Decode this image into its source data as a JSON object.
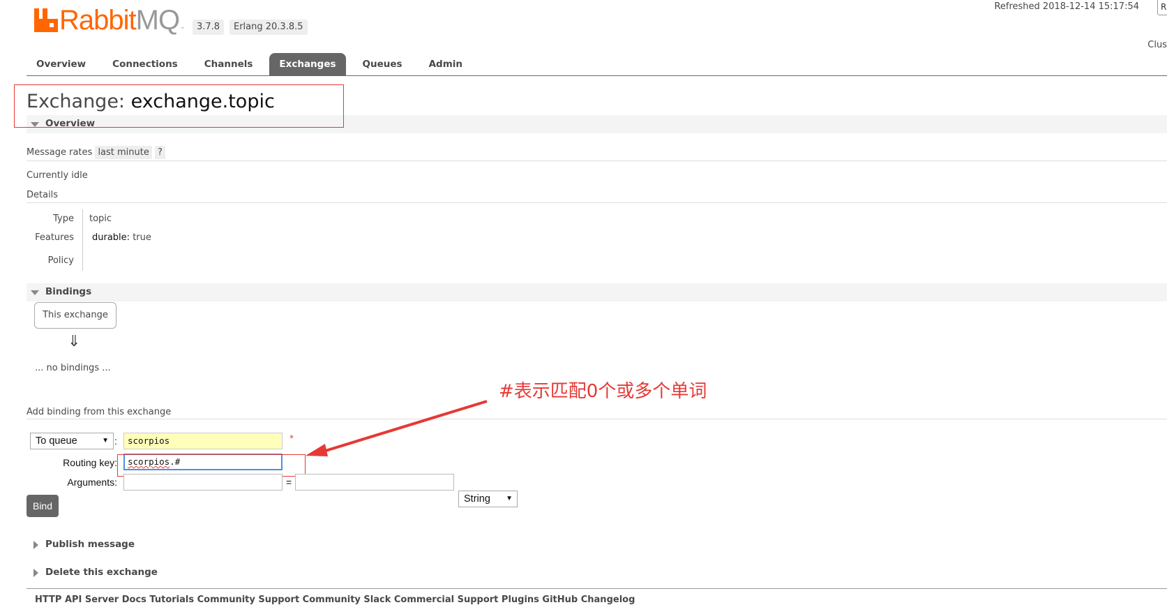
{
  "header": {
    "logo_text": "RabbitMQ",
    "version": "3.7.8",
    "erlang": "Erlang 20.3.8.5",
    "refreshed": "Refreshed 2018-12-14 15:17:54",
    "refresh_button_label": "R",
    "cluster_label": "Clus"
  },
  "tabs": [
    {
      "label": "Overview",
      "active": false
    },
    {
      "label": "Connections",
      "active": false
    },
    {
      "label": "Channels",
      "active": false
    },
    {
      "label": "Exchanges",
      "active": true
    },
    {
      "label": "Queues",
      "active": false
    },
    {
      "label": "Admin",
      "active": false
    }
  ],
  "page": {
    "title_prefix": "Exchange:",
    "title_name": "exchange.topic"
  },
  "overview": {
    "section_label": "Overview",
    "message_rates_label": "Message rates",
    "message_rates_value": "last minute",
    "help_label": "?",
    "idle_text": "Currently idle",
    "details_label": "Details",
    "type_label": "Type",
    "type_value": "topic",
    "features_label": "Features",
    "durable_label": "durable:",
    "durable_value": "true",
    "policy_label": "Policy",
    "policy_value": ""
  },
  "bindings": {
    "section_label": "Bindings",
    "this_exchange_label": "This exchange",
    "arrow": "⇓",
    "no_bindings_text": "... no bindings ..."
  },
  "add_binding": {
    "heading": "Add binding from this exchange",
    "destination_type": "To queue",
    "colon": ":",
    "destination_value": "scorpios",
    "required_mark": "*",
    "routing_key_label": "Routing key:",
    "routing_key_word": "scorpios",
    "routing_key_suffix": ".#",
    "arguments_label": "Arguments:",
    "argument_key": "",
    "equals": "=",
    "argument_value": "",
    "argument_type": "String",
    "bind_label": "Bind"
  },
  "collapsed_sections": {
    "publish_label": "Publish message",
    "delete_label": "Delete this exchange"
  },
  "annotation": {
    "text": "#表示匹配0个或多个单词",
    "color": "#e53935"
  },
  "footer": {
    "links_text": "HTTP API    Server Docs    Tutorials    Community Support    Community Slack    Commercial Support    Plugins    GitHub    Changelog"
  },
  "colors": {
    "brand_orange": "#ff6600",
    "tab_active_bg": "#666666",
    "input_highlight": "#ffffbb",
    "focus_border": "#4a90e2"
  }
}
